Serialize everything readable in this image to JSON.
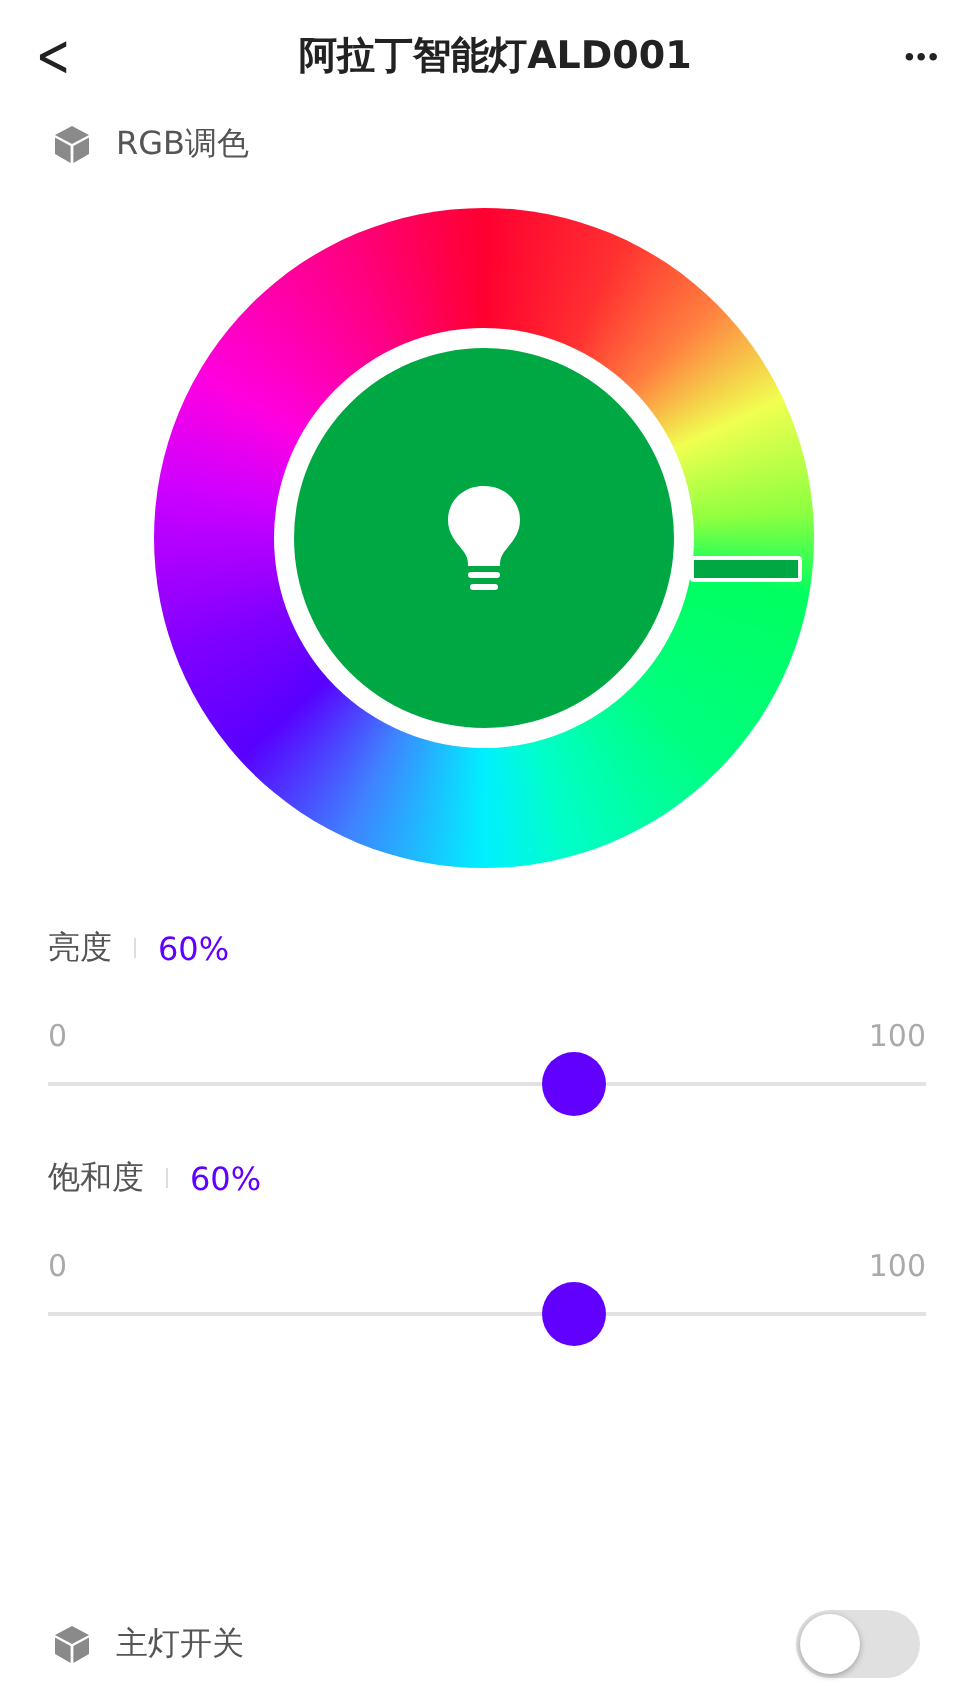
{
  "header": {
    "back": "<",
    "title": "阿拉丁智能灯ALD001",
    "more": "•••"
  },
  "rgb": {
    "label": "RGB调色"
  },
  "sliders": [
    {
      "label": "亮度",
      "reading": "60%",
      "min": "0",
      "max": "100",
      "level": 0.6
    },
    {
      "label": "饱和度",
      "reading": "60%",
      "min": "0",
      "max": "100",
      "level": 0.6
    }
  ],
  "main_switch": {
    "label": "主灯开关",
    "on": false
  }
}
